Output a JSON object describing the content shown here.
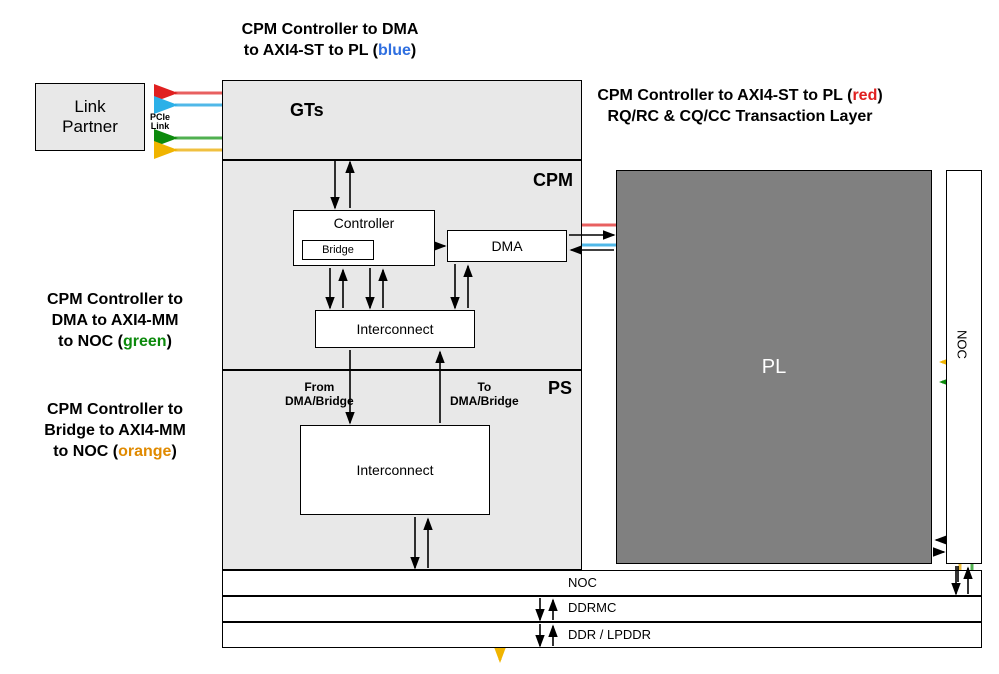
{
  "captions": {
    "top_blue": {
      "part1": "CPM Controller to DMA",
      "part2": "to AXI4-ST to PL (",
      "kw": "blue",
      "close": ")"
    },
    "top_red": {
      "part1": "CPM Controller to AXI4-ST to PL (",
      "kw": "red",
      "close": ")",
      "part2": "RQ/RC & CQ/CC Transaction Layer"
    },
    "left_green": {
      "l1": "CPM Controller to",
      "l2": "DMA to AXI4-MM",
      "l3": "to NOC (",
      "kw": "green",
      "close": ")"
    },
    "left_orange": {
      "l1": "CPM Controller to",
      "l2": "Bridge to AXI4-MM",
      "l3": "to NOC (",
      "kw": "orange",
      "close": ")"
    }
  },
  "blocks": {
    "link_partner": "Link\nPartner",
    "gts": "GTs",
    "cpm": "CPM",
    "ps": "PS",
    "pl": "PL",
    "controller": "Controller",
    "bridge": "Bridge",
    "dma": "DMA",
    "interconnect1": "Interconnect",
    "interconnect2": "Interconnect",
    "from_dma": "From\nDMA/Bridge",
    "to_dma": "To\nDMA/Bridge",
    "noc": "NOC",
    "noc_v": "NOC",
    "ddrmc": "DDRMC",
    "ddr": "DDR / LPDDR",
    "pcie_link": "PCIe\nLink"
  }
}
